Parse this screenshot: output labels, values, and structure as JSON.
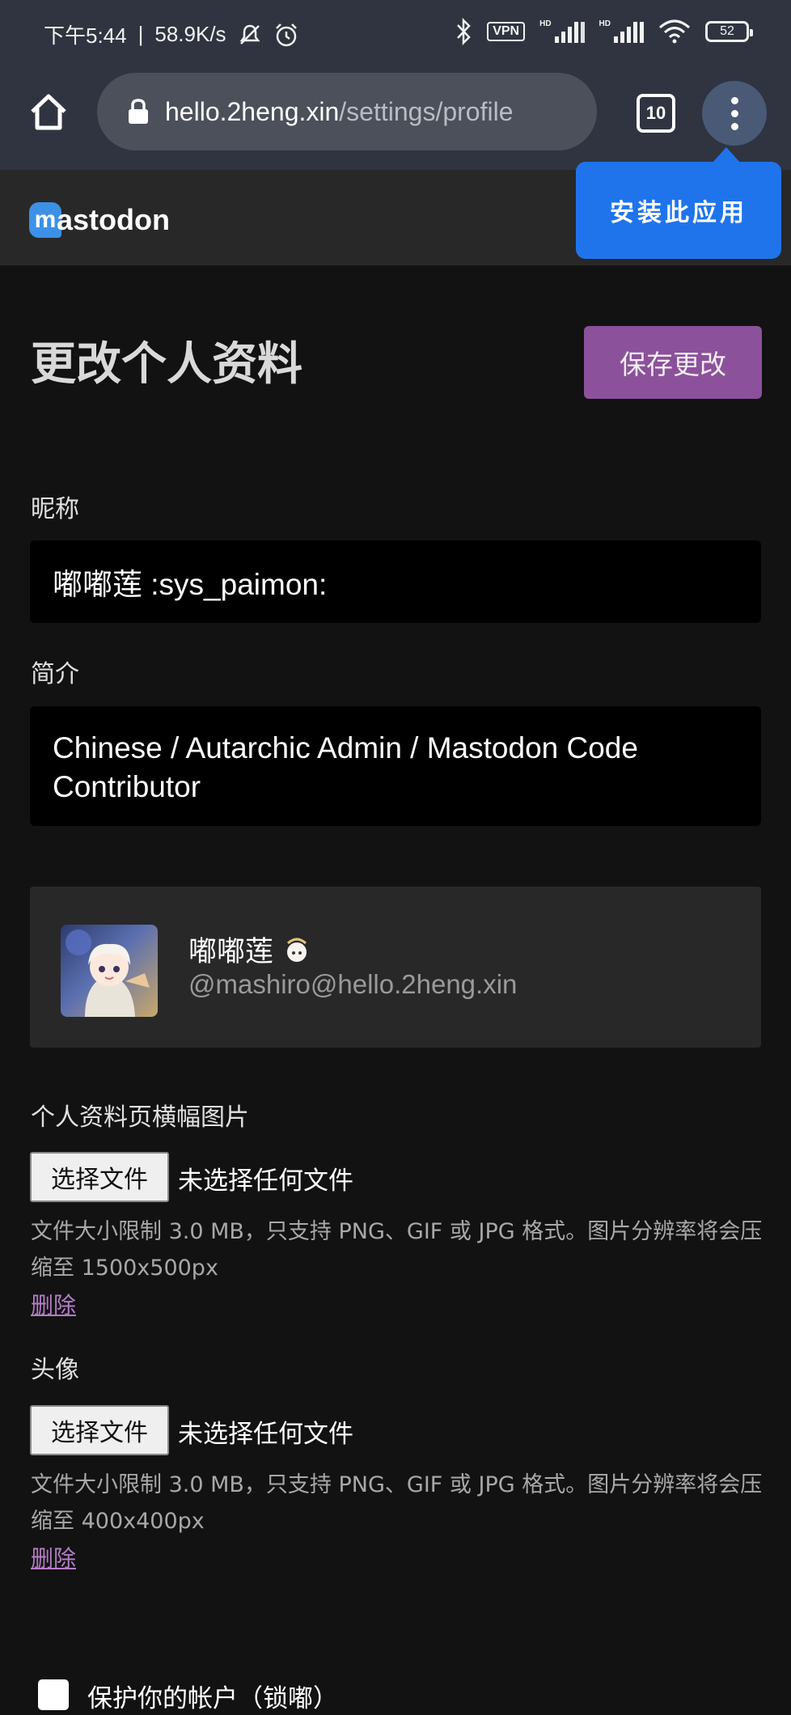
{
  "status_bar": {
    "time": "下午5:44",
    "separator": "|",
    "net_speed": "58.9K/s",
    "vpn": "VPN",
    "hd": "HD",
    "battery": "52"
  },
  "browser": {
    "url_host": "hello.2heng.xin",
    "url_path": "/settings/profile",
    "tab_count": "10",
    "install_popup": "安装此应用"
  },
  "header": {
    "logo_mark": "m",
    "logo_text": "astodon"
  },
  "page": {
    "title": "更改个人资料",
    "save_label": "保存更改"
  },
  "form": {
    "display_name_label": "昵称",
    "display_name_value": "嘟嘟莲 :sys_paimon:",
    "bio_label": "简介",
    "bio_value": "Chinese / Autarchic Admin / Mastodon Code Contributor"
  },
  "preview": {
    "display_name": "嘟嘟莲",
    "handle": "@mashiro@hello.2heng.xin"
  },
  "header_image": {
    "label": "个人资料页横幅图片",
    "button": "选择文件",
    "no_file": "未选择任何文件",
    "hint": "文件大小限制 3.0 MB，只支持 PNG、GIF 或 JPG 格式。图片分辨率将会压缩至 1500x500px",
    "delete": "删除"
  },
  "avatar_image": {
    "label": "头像",
    "button": "选择文件",
    "no_file": "未选择任何文件",
    "hint": "文件大小限制 3.0 MB，只支持 PNG、GIF 或 JPG 格式。图片分辨率将会压缩至 400x400px",
    "delete": "删除"
  },
  "lock_account": {
    "label": "保护你的帐户（锁嘟）",
    "checked": false
  },
  "colors": {
    "accent": "#8c519b",
    "link": "#b47cc6",
    "install_blue": "#1f74ec",
    "mastodon_blue": "#3c91e6"
  }
}
